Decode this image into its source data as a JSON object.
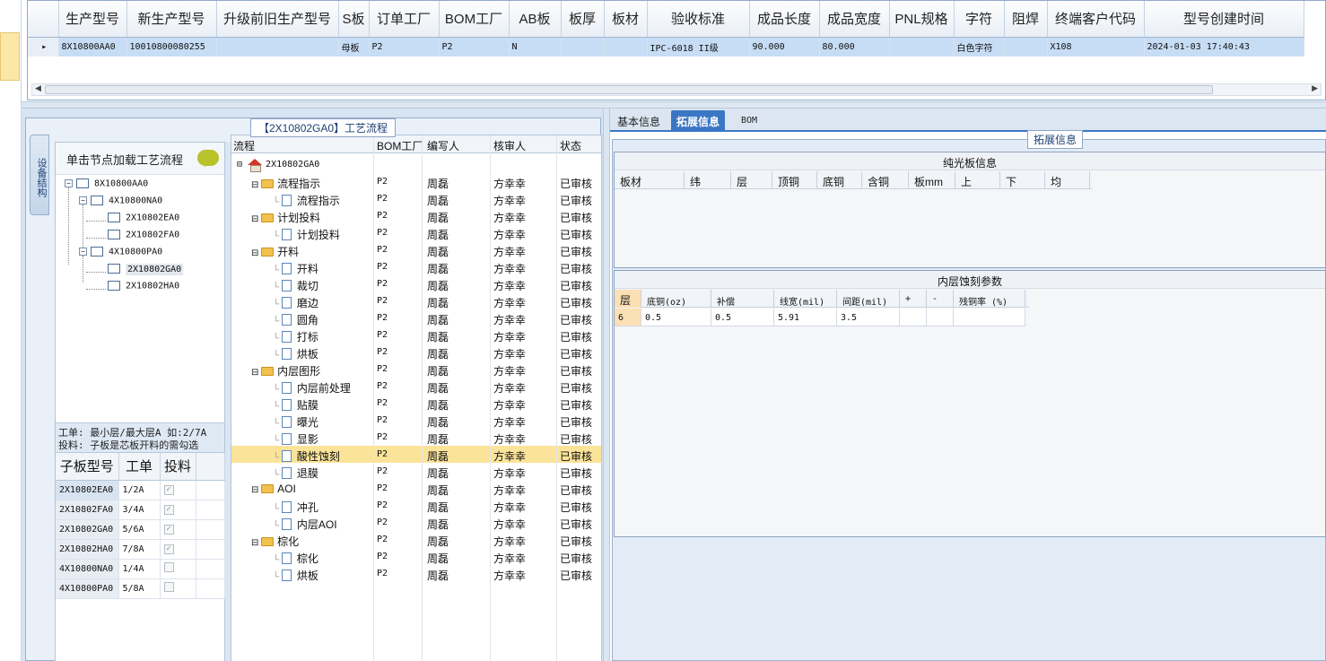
{
  "top_grid": {
    "columns": [
      "生产型号",
      "新生产型号",
      "升级前旧生产型号",
      "S板",
      "订单工厂",
      "BOM工厂",
      "AB板",
      "板厚",
      "板材",
      "验收标准",
      "成品长度",
      "成品宽度",
      "PNL规格",
      "字符",
      "阻焊",
      "终端客户代码",
      "型号创建时间"
    ],
    "row": [
      "8X10800AA0",
      "10010800080255",
      "",
      "母板",
      "P2",
      "P2",
      "N",
      "",
      "",
      "IPC-6018 II级",
      "90.000",
      "80.000",
      "",
      "白色字符",
      "",
      "X108",
      "2024-01-03 17:40:43"
    ]
  },
  "process_group": {
    "title": "【2X10802GA0】工艺流程",
    "vertical_tab": "设备结构"
  },
  "left_panel": {
    "hint": "单击节点加载工艺流程",
    "nodes": [
      {
        "label": "8X10800AA0"
      },
      {
        "label": "4X10800NA0"
      },
      {
        "label": "2X10802EA0"
      },
      {
        "label": "2X10802FA0"
      },
      {
        "label": "4X10800PA0"
      },
      {
        "label": "2X10802GA0"
      },
      {
        "label": "2X10802HA0"
      }
    ],
    "note_line1": "工单: 最小层/最大层A 如:2/7A",
    "note_line2": "投料: 子板是芯板开料的需勾选",
    "sub_grid": {
      "headers": [
        "子板型号",
        "工单",
        "投料"
      ],
      "rows": [
        {
          "model": "2X10802EA0",
          "order": "1/2A",
          "checked": true
        },
        {
          "model": "2X10802FA0",
          "order": "3/4A",
          "checked": true
        },
        {
          "model": "2X10802GA0",
          "order": "5/6A",
          "checked": true
        },
        {
          "model": "2X10802HA0",
          "order": "7/8A",
          "checked": true
        },
        {
          "model": "4X10800NA0",
          "order": "1/4A",
          "checked": false
        },
        {
          "model": "4X10800PA0",
          "order": "5/8A",
          "checked": false
        }
      ]
    }
  },
  "flow_tree": {
    "headers": [
      "流程",
      "BOM工厂",
      "编写人",
      "核审人",
      "状态"
    ],
    "root": "2X10802GA0",
    "rows": [
      {
        "name": "流程指示",
        "level": 1,
        "folder": true,
        "bom": "P2",
        "writer": "周磊",
        "reviewer": "方幸幸",
        "status": "已审核"
      },
      {
        "name": "流程指示",
        "level": 2,
        "folder": false,
        "bom": "P2",
        "writer": "周磊",
        "reviewer": "方幸幸",
        "status": "已审核"
      },
      {
        "name": "计划投料",
        "level": 1,
        "folder": true,
        "bom": "P2",
        "writer": "周磊",
        "reviewer": "方幸幸",
        "status": "已审核"
      },
      {
        "name": "计划投料",
        "level": 2,
        "folder": false,
        "bom": "P2",
        "writer": "周磊",
        "reviewer": "方幸幸",
        "status": "已审核"
      },
      {
        "name": "开料",
        "level": 1,
        "folder": true,
        "bom": "P2",
        "writer": "周磊",
        "reviewer": "方幸幸",
        "status": "已审核"
      },
      {
        "name": "开料",
        "level": 2,
        "folder": false,
        "bom": "P2",
        "writer": "周磊",
        "reviewer": "方幸幸",
        "status": "已审核"
      },
      {
        "name": "裁切",
        "level": 2,
        "folder": false,
        "bom": "P2",
        "writer": "周磊",
        "reviewer": "方幸幸",
        "status": "已审核"
      },
      {
        "name": "磨边",
        "level": 2,
        "folder": false,
        "bom": "P2",
        "writer": "周磊",
        "reviewer": "方幸幸",
        "status": "已审核"
      },
      {
        "name": "圆角",
        "level": 2,
        "folder": false,
        "bom": "P2",
        "writer": "周磊",
        "reviewer": "方幸幸",
        "status": "已审核"
      },
      {
        "name": "打标",
        "level": 2,
        "folder": false,
        "bom": "P2",
        "writer": "周磊",
        "reviewer": "方幸幸",
        "status": "已审核"
      },
      {
        "name": "烘板",
        "level": 2,
        "folder": false,
        "bom": "P2",
        "writer": "周磊",
        "reviewer": "方幸幸",
        "status": "已审核"
      },
      {
        "name": "内层图形",
        "level": 1,
        "folder": true,
        "bom": "P2",
        "writer": "周磊",
        "reviewer": "方幸幸",
        "status": "已审核"
      },
      {
        "name": "内层前处理",
        "level": 2,
        "folder": false,
        "bom": "P2",
        "writer": "周磊",
        "reviewer": "方幸幸",
        "status": "已审核"
      },
      {
        "name": "贴膜",
        "level": 2,
        "folder": false,
        "bom": "P2",
        "writer": "周磊",
        "reviewer": "方幸幸",
        "status": "已审核"
      },
      {
        "name": "曝光",
        "level": 2,
        "folder": false,
        "bom": "P2",
        "writer": "周磊",
        "reviewer": "方幸幸",
        "status": "已审核"
      },
      {
        "name": "显影",
        "level": 2,
        "folder": false,
        "bom": "P2",
        "writer": "周磊",
        "reviewer": "方幸幸",
        "status": "已审核"
      },
      {
        "name": "酸性蚀刻",
        "level": 2,
        "folder": false,
        "bom": "P2",
        "writer": "周磊",
        "reviewer": "方幸幸",
        "status": "已审核",
        "highlight": true
      },
      {
        "name": "退膜",
        "level": 2,
        "folder": false,
        "bom": "P2",
        "writer": "周磊",
        "reviewer": "方幸幸",
        "status": "已审核"
      },
      {
        "name": "AOI",
        "level": 1,
        "folder": true,
        "bom": "P2",
        "writer": "周磊",
        "reviewer": "方幸幸",
        "status": "已审核"
      },
      {
        "name": "冲孔",
        "level": 2,
        "folder": false,
        "bom": "P2",
        "writer": "周磊",
        "reviewer": "方幸幸",
        "status": "已审核"
      },
      {
        "name": "内层AOI",
        "level": 2,
        "folder": false,
        "bom": "P2",
        "writer": "周磊",
        "reviewer": "方幸幸",
        "status": "已审核"
      },
      {
        "name": "棕化",
        "level": 1,
        "folder": true,
        "bom": "P2",
        "writer": "周磊",
        "reviewer": "方幸幸",
        "status": "已审核"
      },
      {
        "name": "棕化",
        "level": 2,
        "folder": false,
        "bom": "P2",
        "writer": "周磊",
        "reviewer": "方幸幸",
        "status": "已审核"
      },
      {
        "name": "烘板",
        "level": 2,
        "folder": false,
        "bom": "P2",
        "writer": "周磊",
        "reviewer": "方幸幸",
        "status": "已审核"
      }
    ]
  },
  "right_panel": {
    "tabs": [
      "基本信息",
      "拓展信息",
      "BOM"
    ],
    "active_tab": "拓展信息",
    "legend": "拓展信息",
    "pure_board": {
      "caption": "纯光板信息",
      "headers": [
        "板材",
        "纬",
        "层",
        "顶铜",
        "底铜",
        "含铜",
        "板mm",
        "上",
        "下",
        "均"
      ]
    },
    "inner_etch": {
      "caption": "内层蚀刻参数",
      "headers": [
        "层",
        "底铜(oz)",
        "补偿",
        "线宽(mil)",
        "间距(mil)",
        "+",
        "-",
        "残铜率 (%)"
      ],
      "rows": [
        [
          "6",
          "0.5",
          "0.5",
          "5.91",
          "3.5",
          "",
          "",
          ""
        ]
      ]
    }
  }
}
